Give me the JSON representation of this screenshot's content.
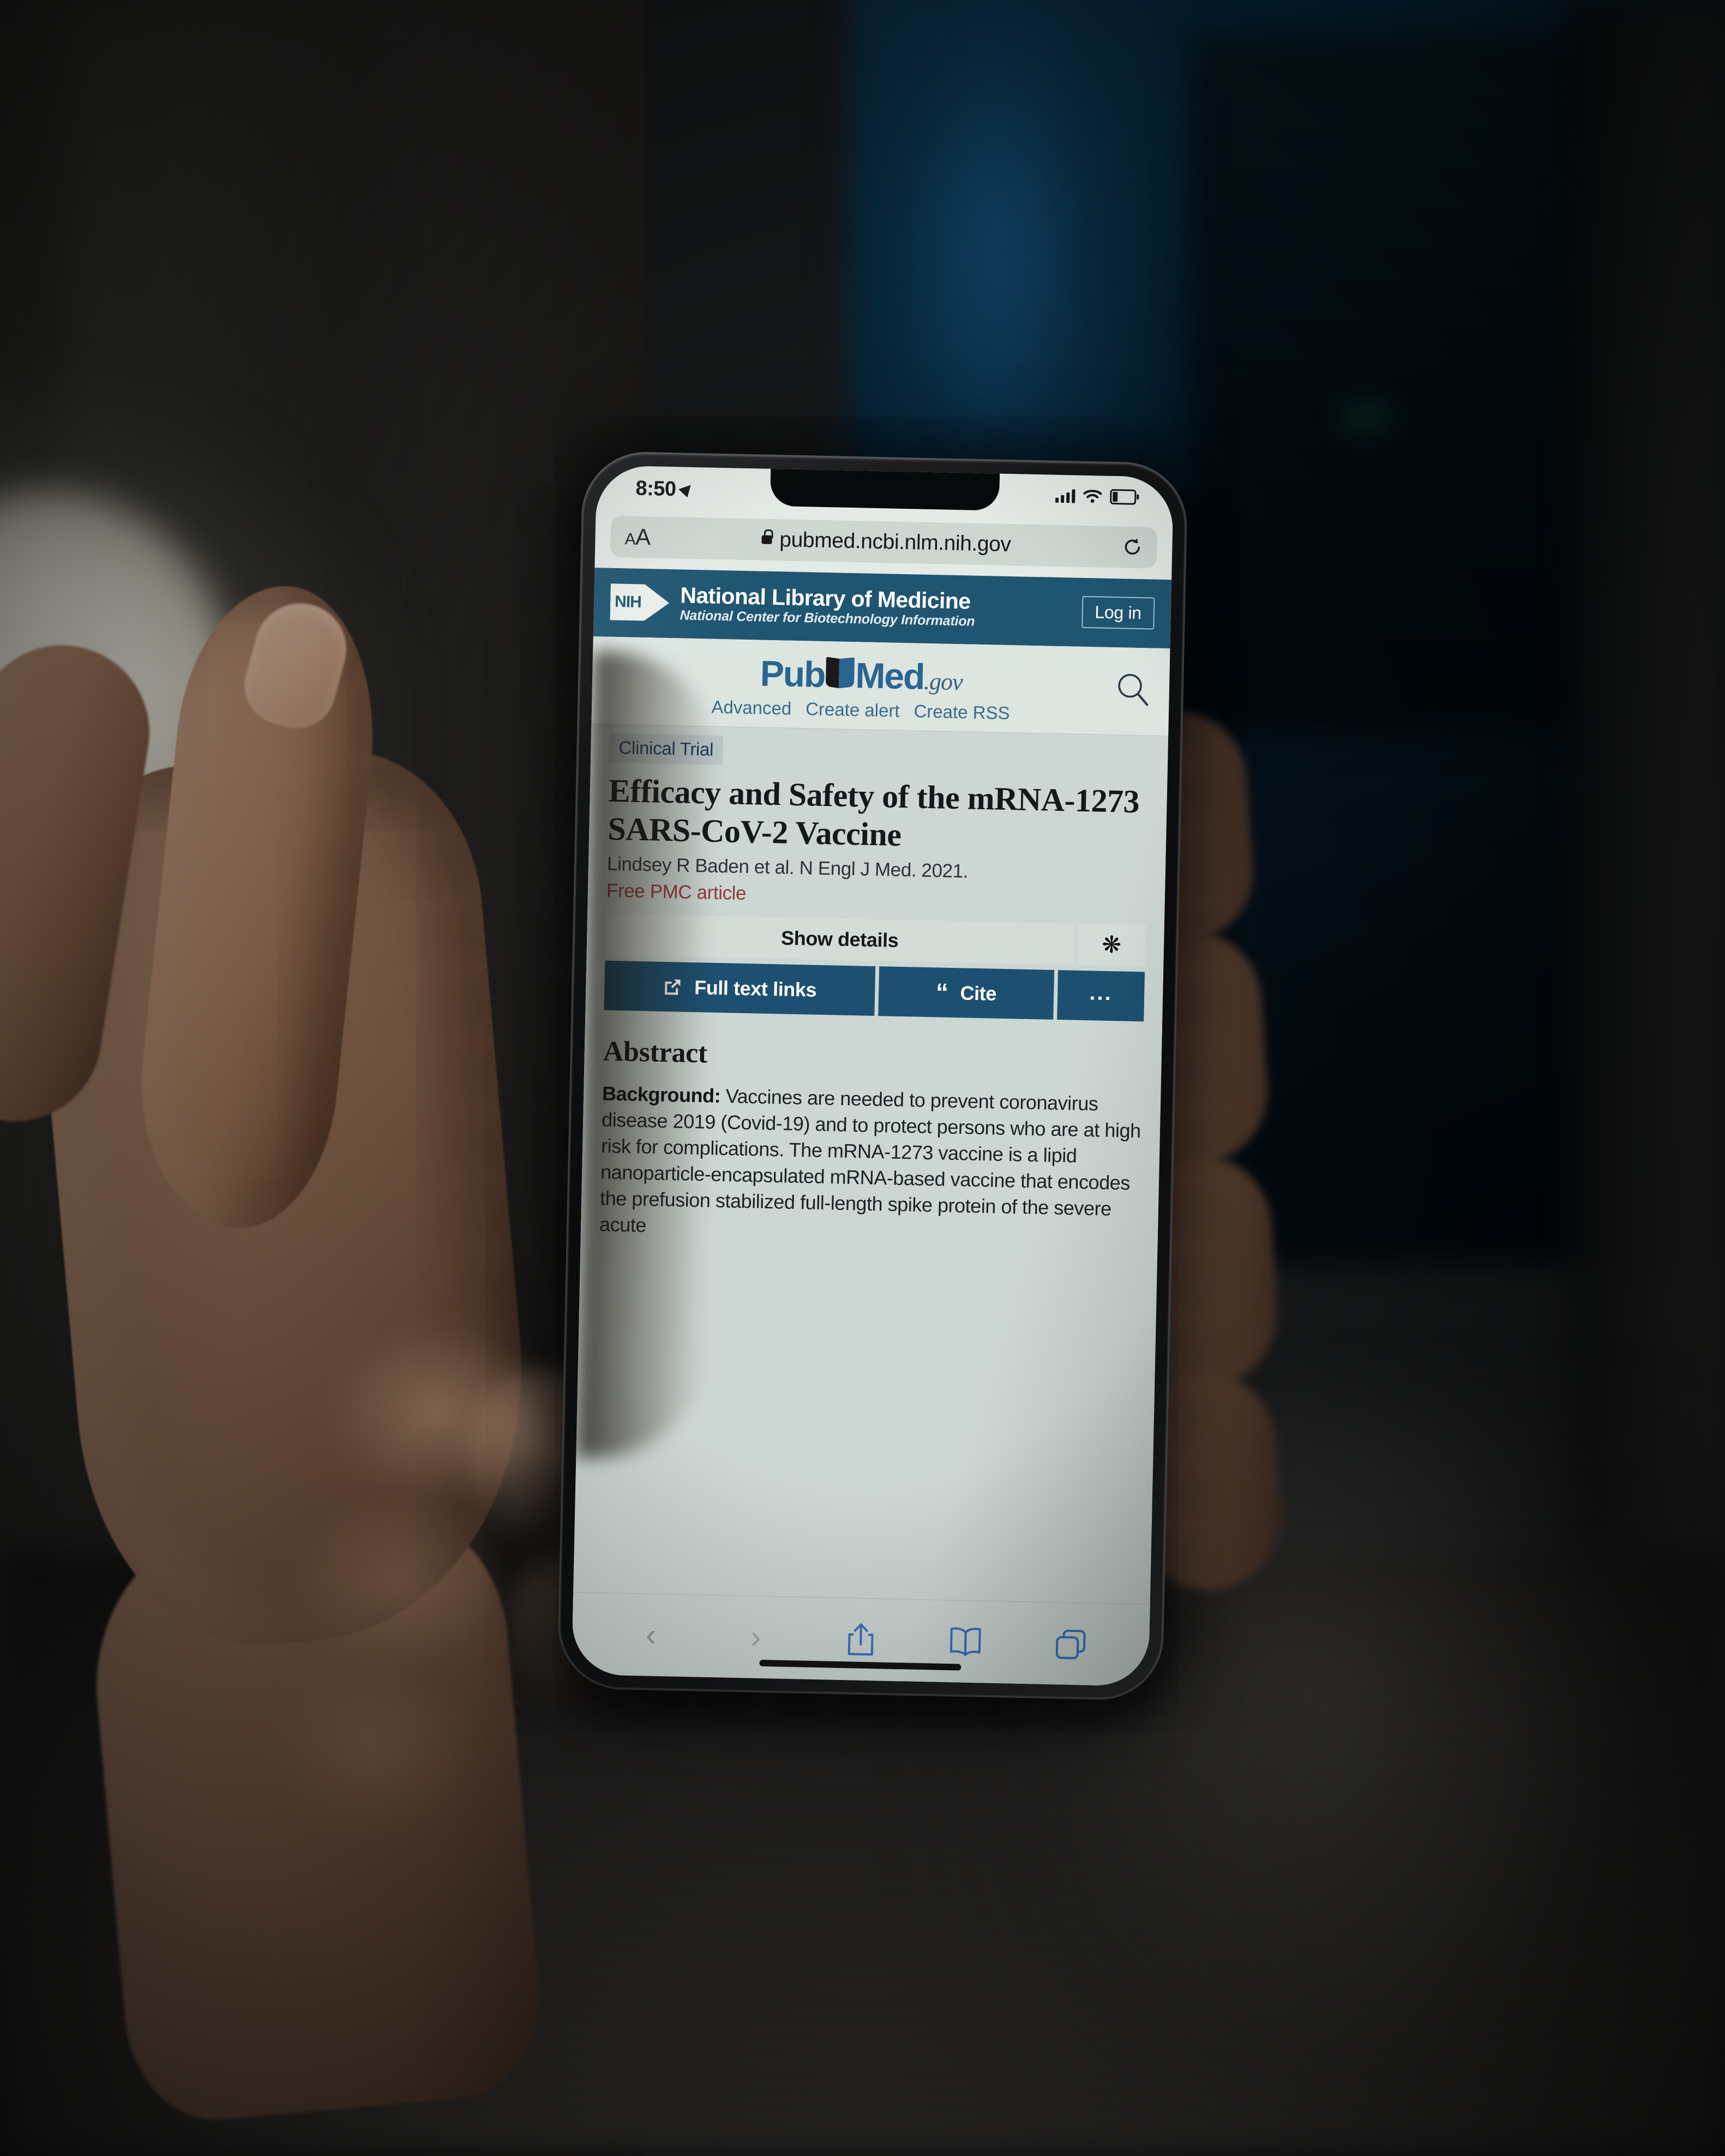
{
  "status_bar": {
    "time": "8:50",
    "location_icon": "location-arrow-icon",
    "signal_icon": "cellular-signal-icon",
    "wifi_icon": "wifi-icon",
    "battery_icon": "battery-low-icon"
  },
  "browser": {
    "text_size_label": "AA",
    "lock_icon": "lock-icon",
    "url": "pubmed.ncbi.nlm.nih.gov",
    "reload_icon": "reload-icon",
    "toolbar": {
      "back_icon": "chevron-left-icon",
      "forward_icon": "chevron-right-icon",
      "share_icon": "share-icon",
      "bookmarks_icon": "book-icon",
      "tabs_icon": "tabs-icon"
    }
  },
  "nih_header": {
    "logo_text": "NIH",
    "title": "National Library of Medicine",
    "subtitle": "National Center for Biotechnology Information",
    "login_label": "Log in"
  },
  "pubmed_header": {
    "logo_pub": "Pub",
    "logo_med": "Med",
    "logo_gov": ".gov",
    "search_icon": "search-icon",
    "links": [
      "Advanced",
      "Create alert",
      "Create RSS"
    ]
  },
  "article": {
    "badge": "Clinical Trial",
    "title": "Efficacy and Safety of the mRNA-1273 SARS-CoV-2 Vaccine",
    "authors": "Lindsey R Baden et al. N Engl J Med. 2021.",
    "free_text": "Free PMC article",
    "show_details_label": "Show details",
    "settings_icon": "gear-icon",
    "buttons": [
      {
        "label": "Full text links",
        "icon": "external-link-icon"
      },
      {
        "label": "Cite",
        "icon": "quote-icon"
      },
      {
        "label": "...",
        "icon": "ellipsis-icon"
      }
    ],
    "abstract_heading": "Abstract",
    "abstract_label": "Background:",
    "abstract_text": " Vaccines are needed to prevent coronavirus disease 2019 (Covid-19) and to protect persons who are at high risk for complications. The mRNA-1273 vaccine is a lipid nanoparticle-encapsulated mRNA-based vaccine that encodes the prefusion stabilized full-length spike protein of the severe acute"
  },
  "colors": {
    "nih_banner": "#1f5571",
    "action_button": "#1d5070",
    "page_background": "#ccd6d2",
    "badge_background": "#b9c6c8",
    "free_article": "#8d3b3f",
    "link_blue": "#3c6b88",
    "toolbar_icon_blue": "#3c6fc4"
  }
}
